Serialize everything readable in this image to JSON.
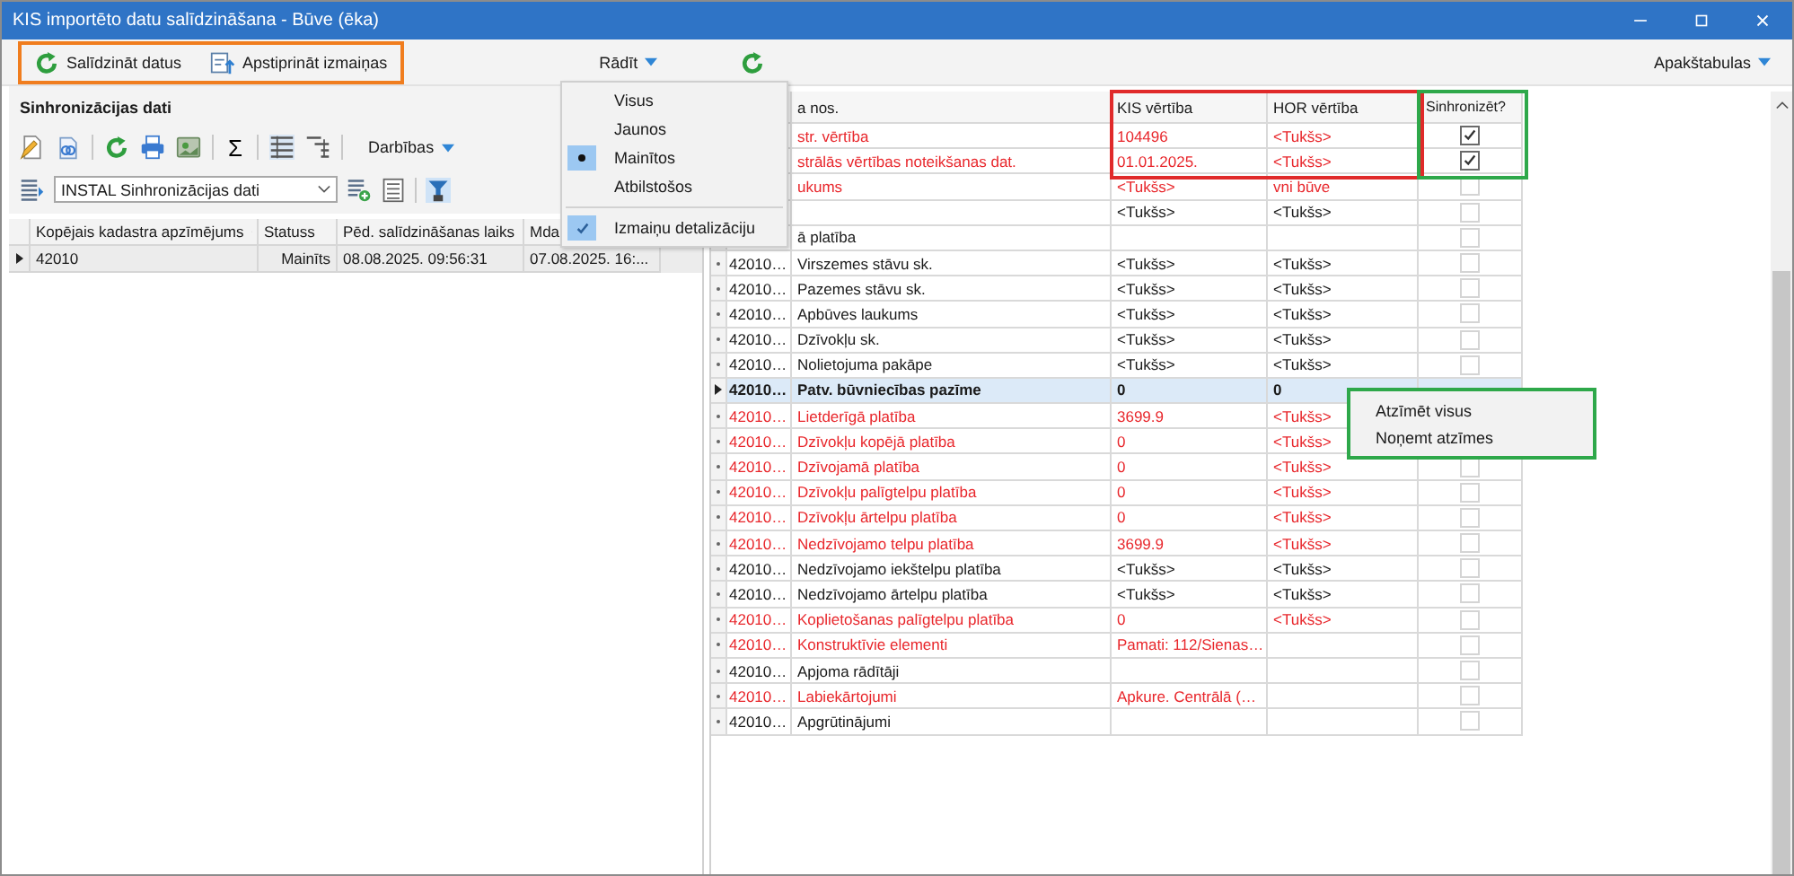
{
  "window": {
    "title": "KIS importēto datu salīdzināšana - Būve (ēka)"
  },
  "toolbar": {
    "buttons": [
      {
        "label": "Salīdzināt datus",
        "kind": "refresh"
      },
      {
        "label": "Apstiprināt izmaiņas",
        "kind": "approve"
      }
    ],
    "view_menu": "Rādīt",
    "subtables_menu": "Apakštabulas"
  },
  "left_panel": {
    "title": "Sinhronizācijas dati",
    "sum_symbol": "Σ",
    "actions_menu": "Darbības",
    "layout_field": "INSTAL Sinhronizācijas dati",
    "table": {
      "columns": [
        {
          "label": "Kopējais kadastra apzīmējums",
          "sorted": true
        },
        {
          "label": "Statuss"
        },
        {
          "label": "Pēd. salīdzināšanas laiks"
        },
        {
          "label": "Mda"
        }
      ],
      "rows": [
        {
          "selected": true,
          "cells": [
            "42010",
            "Mainīts",
            "08.08.2025. 09:56:31",
            "07.08.2025. 16:..."
          ]
        }
      ]
    }
  },
  "view_menu_popup": {
    "items": [
      {
        "kind": "radio",
        "label": "Visus",
        "selected": false
      },
      {
        "kind": "radio",
        "label": "Jaunos",
        "selected": false
      },
      {
        "kind": "radio",
        "label": "Mainītos",
        "selected": true
      },
      {
        "kind": "radio",
        "label": "Atbilstošos",
        "selected": false
      },
      {
        "kind": "check",
        "label": "Izmaiņu detalizāciju",
        "checked": true
      }
    ]
  },
  "grid": {
    "columns": [
      "a nos.",
      "KIS vērtība",
      "HOR vērtība",
      "Sinhronizēt?"
    ],
    "rows": [
      {
        "name": "str. vērtība",
        "kis": "104496",
        "hor": "<Tukšs>",
        "changed": true,
        "selected": false,
        "checked": true
      },
      {
        "name": "strālās vērtības noteikšanas dat.",
        "kis": "01.01.2025.",
        "hor": "<Tukšs>",
        "changed": true,
        "selected": false,
        "checked": true
      },
      {
        "name": "ukums",
        "kis": "<Tukšs>",
        "hor": "vni būve",
        "changed": true,
        "selected": false,
        "checked": false
      },
      {
        "kis": "<Tukšs>",
        "hor": "<Tukšs>",
        "changed": false,
        "selected": false,
        "checked": false
      },
      {
        "name": "ā platība",
        "changed": false,
        "selected": false,
        "checked": false
      },
      {
        "code": "42010…",
        "name": "Virszemes stāvu sk.",
        "kis": "<Tukšs>",
        "hor": "<Tukšs>",
        "changed": false,
        "selected": false,
        "checked": false
      },
      {
        "code": "42010…",
        "name": "Pazemes stāvu sk.",
        "kis": "<Tukšs>",
        "hor": "<Tukšs>",
        "changed": false,
        "selected": false,
        "checked": false
      },
      {
        "code": "42010…",
        "name": "Apbūves laukums",
        "kis": "<Tukšs>",
        "hor": "<Tukšs>",
        "changed": false,
        "selected": false,
        "checked": false
      },
      {
        "code": "42010…",
        "name": "Dzīvokļu sk.",
        "kis": "<Tukšs>",
        "hor": "<Tukšs>",
        "changed": false,
        "selected": false,
        "checked": false
      },
      {
        "code": "42010…",
        "name": "Nolietojuma pakāpe",
        "kis": "<Tukšs>",
        "hor": "<Tukšs>",
        "changed": false,
        "selected": false,
        "checked": false
      },
      {
        "code": "42010…",
        "name": "Patv. būvniecības pazīme",
        "kis": "0",
        "hor": "0",
        "changed": false,
        "selected": true
      },
      {
        "code": "42010…",
        "name": "Lietderīgā platība",
        "kis": "3699.9",
        "hor": "<Tukšs>",
        "changed": true,
        "selected": false
      },
      {
        "code": "42010…",
        "name": "Dzīvokļu kopējā platība",
        "kis": "0",
        "hor": "<Tukšs>",
        "changed": true,
        "selected": false
      },
      {
        "code": "42010…",
        "name": "Dzīvojamā platība",
        "kis": "0",
        "hor": "<Tukšs>",
        "changed": true,
        "selected": false,
        "checked": false
      },
      {
        "code": "42010…",
        "name": "Dzīvokļu palīgtelpu platība",
        "kis": "0",
        "hor": "<Tukšs>",
        "changed": true,
        "selected": false,
        "checked": false
      },
      {
        "code": "42010…",
        "name": "Dzīvokļu ārtelpu platība",
        "kis": "0",
        "hor": "<Tukšs>",
        "changed": true,
        "selected": false,
        "checked": false
      },
      {
        "code": "42010…",
        "name": "Nedzīvojamo telpu platība",
        "kis": "3699.9",
        "hor": "<Tukšs>",
        "changed": true,
        "selected": false,
        "checked": false
      },
      {
        "code": "42010…",
        "name": "Nedzīvojamo iekštelpu platība",
        "kis": "<Tukšs>",
        "hor": "<Tukšs>",
        "changed": false,
        "selected": false,
        "checked": false
      },
      {
        "code": "42010…",
        "name": "Nedzīvojamo ārtelpu platība",
        "kis": "<Tukšs>",
        "hor": "<Tukšs>",
        "changed": false,
        "selected": false,
        "checked": false
      },
      {
        "code": "42010…",
        "name": "Koplietošanas palīgtelpu platība",
        "kis": "0",
        "hor": "<Tukšs>",
        "changed": true,
        "selected": false,
        "checked": false
      },
      {
        "code": "42010…",
        "name": "Konstruktīvie elementi",
        "kis": "Pamati: 112/Sienas…",
        "changed": true,
        "selected": false,
        "checked": false
      },
      {
        "code": "42010…",
        "name": "Apjoma rādītāji",
        "changed": false,
        "selected": false,
        "checked": false
      },
      {
        "code": "42010…",
        "name": "Labiekārtojumi",
        "kis": "Apkure. Centrālā (…",
        "changed": true,
        "selected": false,
        "checked": false
      },
      {
        "code": "42010…",
        "name": "Apgrūtinājumi",
        "changed": false,
        "selected": false,
        "checked": false
      }
    ]
  },
  "context_menu": {
    "items": [
      "Atzīmēt visus",
      "Noņemt atzīmes"
    ]
  },
  "annotations": [
    {
      "kind": "toolbar",
      "color": "#f07d1e"
    },
    {
      "kind": "values",
      "color": "#e02a2a"
    },
    {
      "kind": "sync",
      "color": "#2ea84a"
    },
    {
      "kind": "menu",
      "color": "#2ea84a"
    }
  ]
}
